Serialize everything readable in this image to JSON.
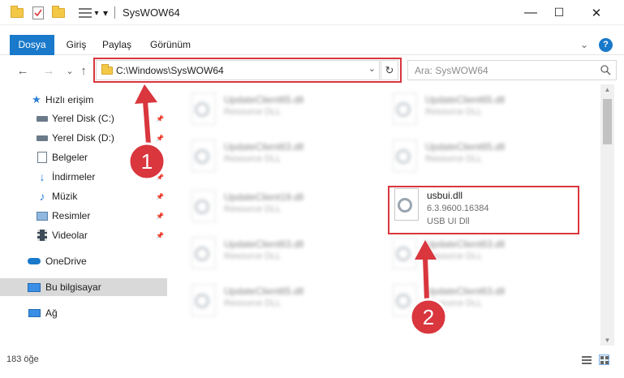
{
  "window": {
    "title": "SysWOW64",
    "minimize_glyph": "—",
    "maximize_glyph": "☐",
    "close_glyph": "✕"
  },
  "quick_access_toolbar": {
    "icons": [
      "folder-icon",
      "properties-check-icon",
      "new-folder-icon",
      "customize-icon"
    ],
    "dropdown_glyph": "▾"
  },
  "ribbon": {
    "tabs": [
      {
        "label": "Dosya",
        "active": true
      },
      {
        "label": "Giriş",
        "active": false
      },
      {
        "label": "Paylaş",
        "active": false
      },
      {
        "label": "Görünüm",
        "active": false
      }
    ],
    "expand_glyph": "⌄",
    "help_glyph": "?"
  },
  "address_bar": {
    "back_glyph": "←",
    "forward_glyph": "→",
    "recent_glyph": "⌄",
    "up_glyph": "↑",
    "path": "C:\\Windows\\SysWOW64",
    "dropdown_glyph": "⌄",
    "refresh_glyph": "↻"
  },
  "search": {
    "placeholder": "Ara: SysWOW64",
    "icon": "search-icon"
  },
  "nav_pane": {
    "items": [
      {
        "label": "Hızlı erişim",
        "icon": "star-icon",
        "pinned": false
      },
      {
        "label": "Yerel Disk (C:)",
        "icon": "drive-icon",
        "pinned": true
      },
      {
        "label": "Yerel Disk (D:)",
        "icon": "drive-icon",
        "pinned": true
      },
      {
        "label": "Belgeler",
        "icon": "documents-icon",
        "pinned": true
      },
      {
        "label": "İndirmeler",
        "icon": "download-icon",
        "pinned": true
      },
      {
        "label": "Müzik",
        "icon": "music-icon",
        "pinned": true
      },
      {
        "label": "Resimler",
        "icon": "pictures-icon",
        "pinned": true
      },
      {
        "label": "Videolar",
        "icon": "video-icon",
        "pinned": true
      },
      {
        "label": "OneDrive",
        "icon": "cloud-icon",
        "pinned": false
      },
      {
        "label": "Bu bilgisayar",
        "icon": "computer-icon",
        "pinned": false,
        "selected": true
      },
      {
        "label": "Ağ",
        "icon": "network-icon",
        "pinned": false
      }
    ],
    "pin_glyph": "📌"
  },
  "files": {
    "left_column": [
      {
        "name": "UpdateClient65.dll",
        "type": "Resource DLL"
      },
      {
        "name": "UpdateClient63.dll",
        "type": "Resource DLL"
      },
      {
        "name": "UpdateClient19.dll",
        "type": "Resource DLL"
      },
      {
        "name": "UpdateClient63.dll",
        "type": "Resource DLL"
      },
      {
        "name": "UpdateClient65.dll",
        "type": "Resource DLL"
      }
    ],
    "right_column": [
      {
        "name": "UpdateClient65.dll",
        "type": "Resource DLL"
      },
      {
        "name": "UpdateClient65.dll",
        "type": "Resource DLL"
      },
      {
        "name": "UpdateClient63.dll",
        "type": "Resource DLL"
      },
      {
        "name": "UpdateClient63.dll",
        "type": "Resource DLL"
      }
    ],
    "highlighted": {
      "name": "usbui.dll",
      "version": "6.3.9600.16384",
      "description": "USB UI Dll"
    }
  },
  "annotations": {
    "badge_1": "1",
    "badge_2": "2",
    "color": "#d9363e"
  },
  "status_bar": {
    "item_count": "183 öğe"
  },
  "colors": {
    "accent": "#1979ca",
    "highlight": "#d9363e",
    "folder": "#f3c847"
  }
}
